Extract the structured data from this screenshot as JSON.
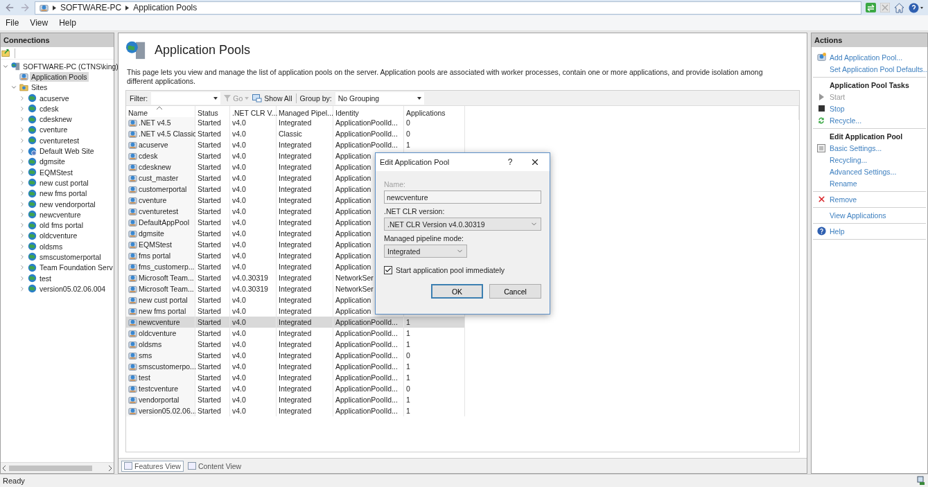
{
  "address_bar": {
    "breadcrumb": [
      "SOFTWARE-PC",
      "Application Pools"
    ]
  },
  "menu": [
    "File",
    "View",
    "Help"
  ],
  "connections": {
    "title": "Connections",
    "tree": [
      {
        "label": "SOFTWARE-PC (CTNS\\king)",
        "kind": "server",
        "expanded": true,
        "selected": false,
        "children": [
          {
            "label": "Application Pools",
            "kind": "pools",
            "selected": true
          },
          {
            "label": "Sites",
            "kind": "folder",
            "expanded": true,
            "selected": false,
            "children": [
              {
                "label": "acuserve",
                "kind": "site",
                "expanded": false,
                "selected": false
              },
              {
                "label": "cdesk",
                "kind": "site",
                "expanded": false,
                "selected": false
              },
              {
                "label": "cdesknew",
                "kind": "site",
                "expanded": false,
                "selected": false
              },
              {
                "label": "cventure",
                "kind": "site",
                "expanded": false,
                "selected": false
              },
              {
                "label": "cventuretest",
                "kind": "site",
                "expanded": false,
                "selected": false
              },
              {
                "label": "Default Web Site",
                "kind": "default-site",
                "expanded": false,
                "selected": false
              },
              {
                "label": "dgmsite",
                "kind": "site",
                "expanded": false,
                "selected": false
              },
              {
                "label": "EQMStest",
                "kind": "site",
                "expanded": false,
                "selected": false
              },
              {
                "label": "new cust portal",
                "kind": "site",
                "expanded": false,
                "selected": false
              },
              {
                "label": "new fms portal",
                "kind": "site",
                "expanded": false,
                "selected": false
              },
              {
                "label": "new vendorportal",
                "kind": "site",
                "expanded": false,
                "selected": false
              },
              {
                "label": "newcventure",
                "kind": "site",
                "expanded": false,
                "selected": false
              },
              {
                "label": "old fms portal",
                "kind": "site",
                "expanded": false,
                "selected": false
              },
              {
                "label": "oldcventure",
                "kind": "site",
                "expanded": false,
                "selected": false
              },
              {
                "label": "oldsms",
                "kind": "site",
                "expanded": false,
                "selected": false
              },
              {
                "label": "smscustomerportal",
                "kind": "site",
                "expanded": false,
                "selected": false
              },
              {
                "label": "Team Foundation Serv",
                "kind": "site",
                "expanded": false,
                "selected": false
              },
              {
                "label": "test",
                "kind": "site",
                "expanded": false,
                "selected": false
              },
              {
                "label": "version05.02.06.004",
                "kind": "site",
                "expanded": false,
                "selected": false
              }
            ]
          }
        ]
      }
    ]
  },
  "page": {
    "title": "Application Pools",
    "description": "This page lets you view and manage the list of application pools on the server. Application pools are associated with worker processes, contain one or more applications, and provide isolation among different applications.",
    "filter": {
      "label": "Filter:",
      "go": "Go",
      "show_all": "Show All",
      "group_by_label": "Group by:",
      "group_by": "No Grouping"
    },
    "table": {
      "columns": [
        "Name",
        "Status",
        ".NET CLR V...",
        "Managed Pipel...",
        "Identity",
        "Applications"
      ],
      "rows": [
        {
          "cells": [
            ".NET v4.5",
            "Started",
            "v4.0",
            "Integrated",
            "ApplicationPoolId...",
            "0"
          ],
          "selected": false
        },
        {
          "cells": [
            ".NET v4.5 Classic",
            "Started",
            "v4.0",
            "Classic",
            "ApplicationPoolId...",
            "0"
          ],
          "selected": false
        },
        {
          "cells": [
            "acuserve",
            "Started",
            "v4.0",
            "Integrated",
            "ApplicationPoolId...",
            "1"
          ],
          "selected": false
        },
        {
          "cells": [
            "cdesk",
            "Started",
            "v4.0",
            "Integrated",
            "Application"
          ],
          "selected": false
        },
        {
          "cells": [
            "cdesknew",
            "Started",
            "v4.0",
            "Integrated",
            "Application"
          ],
          "selected": false
        },
        {
          "cells": [
            "cust_master",
            "Started",
            "v4.0",
            "Integrated",
            "Application"
          ],
          "selected": false
        },
        {
          "cells": [
            "customerportal",
            "Started",
            "v4.0",
            "Integrated",
            "Application"
          ],
          "selected": false
        },
        {
          "cells": [
            "cventure",
            "Started",
            "v4.0",
            "Integrated",
            "Application"
          ],
          "selected": false
        },
        {
          "cells": [
            "cventuretest",
            "Started",
            "v4.0",
            "Integrated",
            "Application"
          ],
          "selected": false
        },
        {
          "cells": [
            "DefaultAppPool",
            "Started",
            "v4.0",
            "Integrated",
            "Application"
          ],
          "selected": false
        },
        {
          "cells": [
            "dgmsite",
            "Started",
            "v4.0",
            "Integrated",
            "Application"
          ],
          "selected": false
        },
        {
          "cells": [
            "EQMStest",
            "Started",
            "v4.0",
            "Integrated",
            "Application"
          ],
          "selected": false
        },
        {
          "cells": [
            "fms portal",
            "Started",
            "v4.0",
            "Integrated",
            "Application"
          ],
          "selected": false
        },
        {
          "cells": [
            "fms_customerp...",
            "Started",
            "v4.0",
            "Integrated",
            "Application"
          ],
          "selected": false
        },
        {
          "cells": [
            "Microsoft Team...",
            "Started",
            "v4.0.30319",
            "Integrated",
            "NetworkSer"
          ],
          "selected": false
        },
        {
          "cells": [
            "Microsoft Team...",
            "Started",
            "v4.0.30319",
            "Integrated",
            "NetworkSer"
          ],
          "selected": false
        },
        {
          "cells": [
            "new cust portal",
            "Started",
            "v4.0",
            "Integrated",
            "Application"
          ],
          "selected": false
        },
        {
          "cells": [
            "new fms portal",
            "Started",
            "v4.0",
            "Integrated",
            "Application"
          ],
          "selected": false
        },
        {
          "cells": [
            "newcventure",
            "Started",
            "v4.0",
            "Integrated",
            "ApplicationPoolId...",
            "1"
          ],
          "selected": true
        },
        {
          "cells": [
            "oldcventure",
            "Started",
            "v4.0",
            "Integrated",
            "ApplicationPoolId...",
            "1"
          ],
          "selected": false
        },
        {
          "cells": [
            "oldsms",
            "Started",
            "v4.0",
            "Integrated",
            "ApplicationPoolId...",
            "1"
          ],
          "selected": false
        },
        {
          "cells": [
            "sms",
            "Started",
            "v4.0",
            "Integrated",
            "ApplicationPoolId...",
            "0"
          ],
          "selected": false
        },
        {
          "cells": [
            "smscustomerpo...",
            "Started",
            "v4.0",
            "Integrated",
            "ApplicationPoolId...",
            "1"
          ],
          "selected": false
        },
        {
          "cells": [
            "test",
            "Started",
            "v4.0",
            "Integrated",
            "ApplicationPoolId...",
            "1"
          ],
          "selected": false
        },
        {
          "cells": [
            "testcventure",
            "Started",
            "v4.0",
            "Integrated",
            "ApplicationPoolId...",
            "0"
          ],
          "selected": false
        },
        {
          "cells": [
            "vendorportal",
            "Started",
            "v4.0",
            "Integrated",
            "ApplicationPoolId...",
            "1"
          ],
          "selected": false
        },
        {
          "cells": [
            "version05.02.06...",
            "Started",
            "v4.0",
            "Integrated",
            "ApplicationPoolId...",
            "1"
          ],
          "selected": false
        }
      ]
    }
  },
  "view_tabs": [
    {
      "label": "Features View",
      "selected": true
    },
    {
      "label": "Content View",
      "selected": false
    }
  ],
  "actions": {
    "title": "Actions",
    "groups": [
      {
        "items": [
          {
            "label": "Add Application Pool...",
            "disabled": false
          },
          {
            "label": "Set Application Pool Defaults...",
            "disabled": false
          }
        ]
      },
      {
        "heading": "Application Pool Tasks",
        "items": [
          {
            "label": "Start",
            "disabled": true
          },
          {
            "label": "Stop",
            "disabled": false
          },
          {
            "label": "Recycle...",
            "disabled": false
          }
        ]
      },
      {
        "heading": "Edit Application Pool",
        "items": [
          {
            "label": "Basic Settings...",
            "disabled": false
          },
          {
            "label": "Recycling...",
            "disabled": false
          },
          {
            "label": "Advanced Settings...",
            "disabled": false
          },
          {
            "label": "Rename",
            "disabled": false
          }
        ]
      },
      {
        "items": [
          {
            "label": "Remove",
            "disabled": false
          }
        ]
      },
      {
        "items": [
          {
            "label": "View Applications",
            "disabled": false
          }
        ]
      },
      {
        "items": [
          {
            "label": "Help",
            "disabled": false
          }
        ]
      }
    ]
  },
  "dialog": {
    "title": "Edit Application Pool",
    "help": "?",
    "name_label": "Name:",
    "name_disabled": true,
    "name_value": "newcventure",
    "clr_label": ".NET CLR version:",
    "clr_value": ".NET CLR Version v4.0.30319",
    "pipeline_label": "Managed pipeline mode:",
    "pipeline_value": "Integrated",
    "start_label": "Start application pool immediately",
    "start_checked": true,
    "buttons": [
      {
        "label": "OK",
        "default": true
      },
      {
        "label": "Cancel",
        "default": false
      }
    ]
  },
  "status_bar": "Ready"
}
